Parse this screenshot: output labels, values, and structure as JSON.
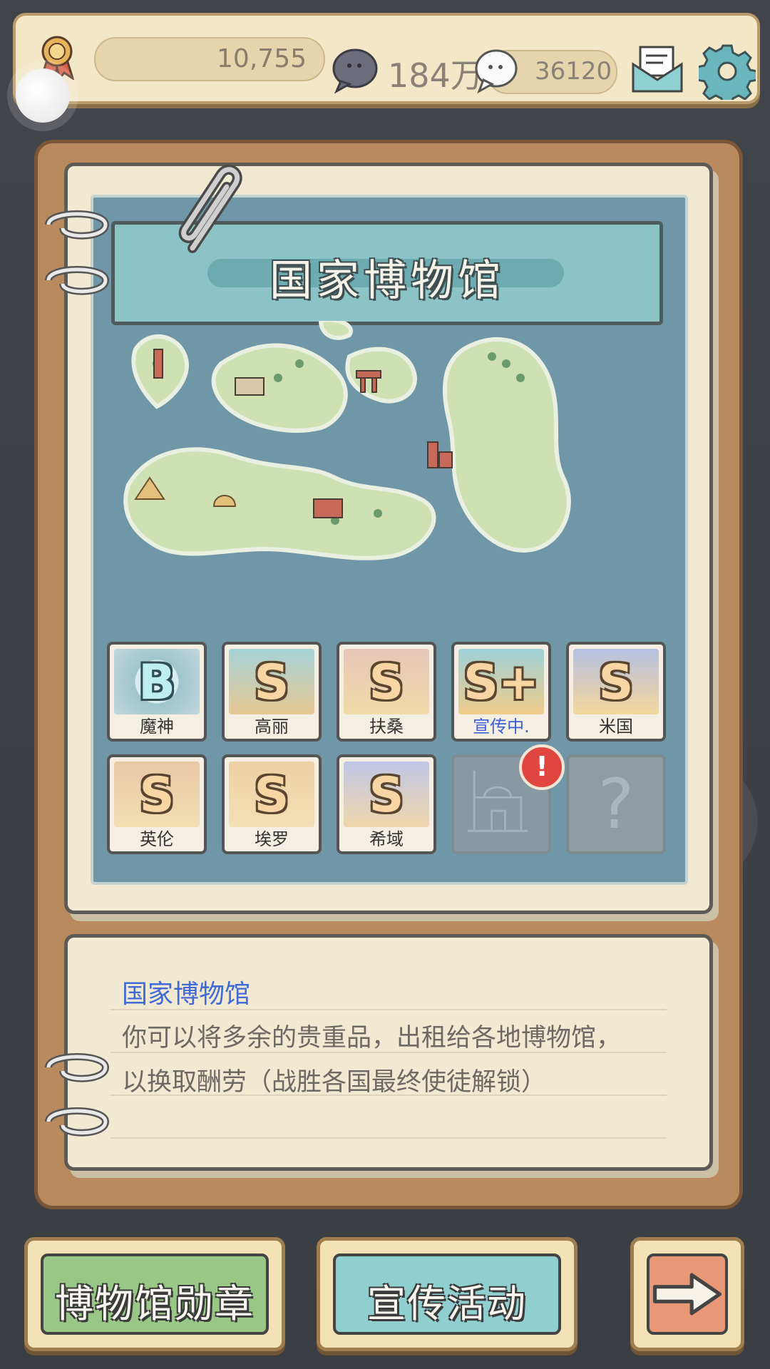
{
  "topbar": {
    "coins": "10,755",
    "bubbles_dark": "184万",
    "bubbles_light": "36120",
    "icons": [
      "medal-icon",
      "speech-bubble-dark-icon",
      "speech-bubble-light-icon",
      "mail-icon",
      "gear-icon"
    ]
  },
  "museum": {
    "title": "国家博物馆",
    "tiles": [
      {
        "grade": "B",
        "label": "魔神",
        "state": "rated"
      },
      {
        "grade": "S",
        "label": "高丽",
        "state": "rated"
      },
      {
        "grade": "S",
        "label": "扶桑",
        "state": "rated"
      },
      {
        "grade": "S+",
        "label": "宣传中.",
        "state": "promoting"
      },
      {
        "grade": "S",
        "label": "米国",
        "state": "rated"
      },
      {
        "grade": "S",
        "label": "英伦",
        "state": "rated"
      },
      {
        "grade": "S",
        "label": "埃罗",
        "state": "rated"
      },
      {
        "grade": "S",
        "label": "希域",
        "state": "rated"
      },
      {
        "grade": "",
        "label": "",
        "state": "locked"
      },
      {
        "grade": "?",
        "label": "",
        "state": "unknown"
      }
    ],
    "alert": "!"
  },
  "description": {
    "title": "国家博物馆",
    "line1": "你可以将多余的贵重品，出租给各地博物馆，",
    "line2": "以换取酬劳（战胜各国最终使徒解锁）"
  },
  "buttons": {
    "medal": "博物馆勋章",
    "promo": "宣传活动"
  },
  "colors": {
    "accent_blue": "#3f6ad8",
    "alert_red": "#e0463f",
    "medal_btn": "#98c786",
    "promo_btn": "#8fcfd0",
    "next_btn": "#e99877"
  }
}
